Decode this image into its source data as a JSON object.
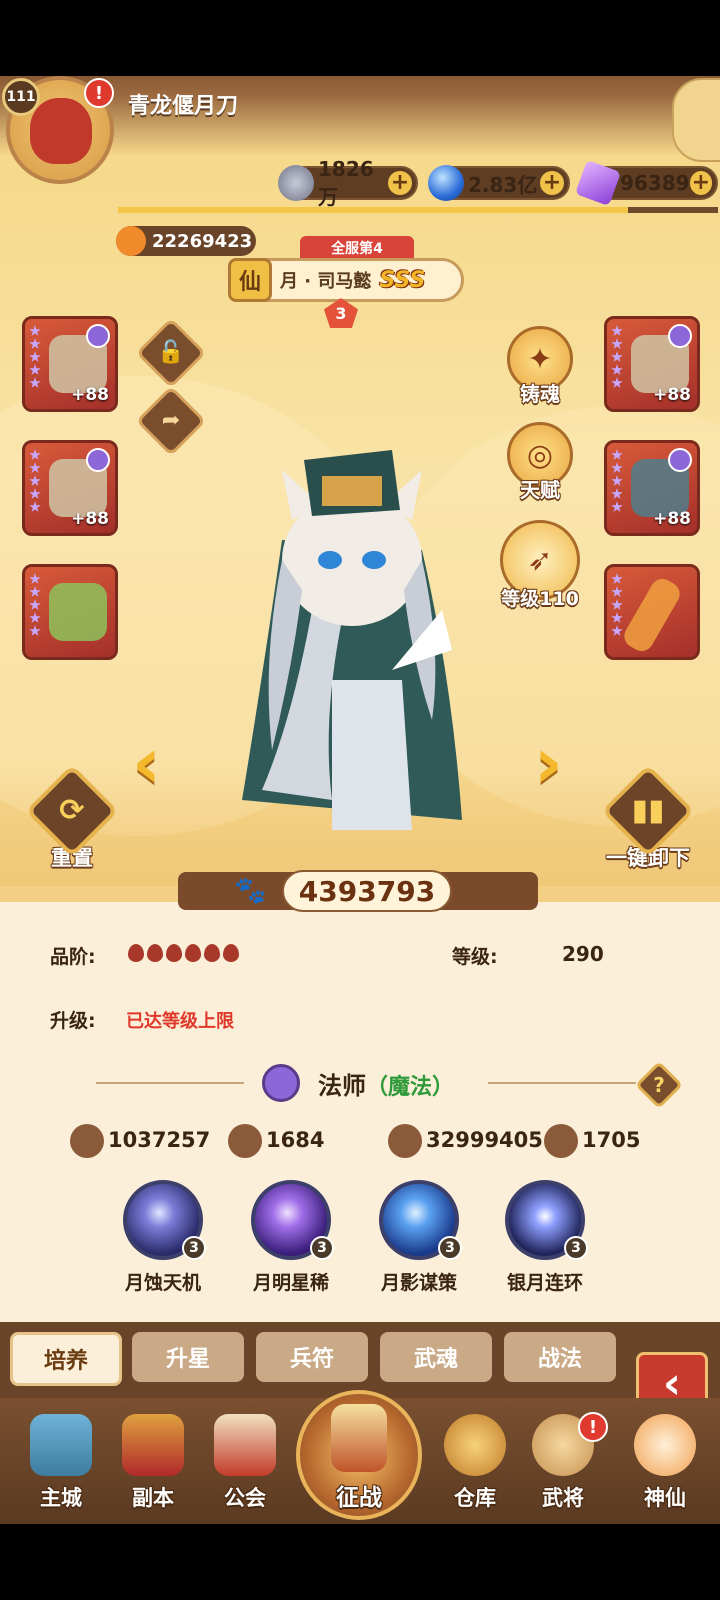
{
  "player": {
    "level": "111",
    "name": "青龙偃月刀",
    "power_id": "22269423",
    "alert": "!"
  },
  "resources": [
    {
      "name": "coin",
      "value": "1826万",
      "icon": "coin-icon",
      "color": "#8a8fa8"
    },
    {
      "name": "orb",
      "value": "2.83亿",
      "icon": "blue-orb-icon",
      "color": "#3c7fe0"
    },
    {
      "name": "crystal",
      "value": "96389",
      "icon": "purple-crystal-icon",
      "color": "#9a55e0"
    }
  ],
  "hero": {
    "rank_tag": "全服第4",
    "badge": "仙",
    "name": "月 · 司马懿",
    "grade": "SSS",
    "star": "3",
    "combat_power": "4393793"
  },
  "equipment_left": [
    {
      "plus": "+88",
      "icon": "axe-icon"
    },
    {
      "plus": "+88",
      "icon": "armor-icon"
    },
    {
      "plus": "",
      "icon": "jade-seal-icon"
    }
  ],
  "equipment_right": [
    {
      "plus": "+88",
      "icon": "helmet-icon"
    },
    {
      "plus": "+88",
      "icon": "shoulder-armor-icon"
    },
    {
      "plus": "",
      "icon": "sword-icon"
    }
  ],
  "actions": {
    "forge": "铸魂",
    "talent": "天赋",
    "level": "等级110",
    "reset": "重置",
    "unequip": "一键卸下"
  },
  "stats": {
    "quality_label": "品阶:",
    "level_label": "等级:",
    "level_value": "290",
    "upgrade_label": "升级:",
    "upgrade_value": "已达等级上限",
    "class_name": "法师",
    "class_type": "（魔法）",
    "attack": "1037257",
    "defense": "1684",
    "hp": "32999405",
    "speed": "1705"
  },
  "skills": [
    {
      "name": "月蚀天机",
      "level": "3"
    },
    {
      "name": "月明星稀",
      "level": "3"
    },
    {
      "name": "月影谋策",
      "level": "3"
    },
    {
      "name": "银月连环",
      "level": "3"
    }
  ],
  "tabs": [
    "培养",
    "升星",
    "兵符",
    "武魂",
    "战法"
  ],
  "active_tab": 0,
  "nav": [
    {
      "label": "主城",
      "icon": "castle-icon"
    },
    {
      "label": "副本",
      "icon": "swords-icon"
    },
    {
      "label": "公会",
      "icon": "guild-flag-icon"
    },
    {
      "label": "征战",
      "icon": "battle-icon"
    },
    {
      "label": "仓库",
      "icon": "treasure-bag-icon"
    },
    {
      "label": "武将",
      "icon": "general-cat-icon"
    },
    {
      "label": "神仙",
      "icon": "immortal-cat-icon"
    }
  ],
  "colors": {
    "accent": "#f4c546",
    "brown": "#6a4428",
    "red": "#e0392b"
  }
}
